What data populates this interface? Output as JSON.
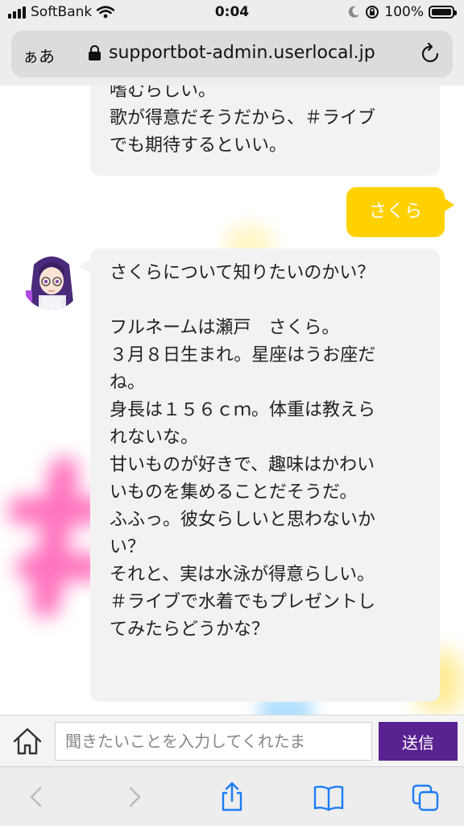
{
  "status_bar": {
    "carrier": "SoftBank",
    "time": "0:04",
    "battery": "100%"
  },
  "browser": {
    "text_size_label": "ぁあ",
    "url": "supportbot-admin.userlocal.jp"
  },
  "messages": {
    "bot_previous": {
      "lines": [
        "嗜むらしい。",
        "歌が得意だそうだから、＃ライブ",
        "でも期待するといい。"
      ]
    },
    "user": {
      "text": "さくら"
    },
    "bot_reply": {
      "lines": [
        "さくらについて知りたいのかい？",
        "",
        "フルネームは瀬戸　さくら。",
        "３月８日生まれ。星座はうお座だ",
        "ね。",
        "身長は１５６ｃｍ。体重は教えら",
        "れないな。",
        "甘いものが好きで、趣味はかわい",
        "いものを集めることだそうだ。",
        "ふふっ。彼女らしいと思わないか",
        "い？",
        "それと、実は水泳が得意らしい。",
        "＃ライブで水着でもプレゼントし",
        "てみたらどうかな？"
      ]
    }
  },
  "input": {
    "placeholder": "聞きたいことを入力してくれたま",
    "send_label": "送信"
  },
  "colors": {
    "user_bubble": "#ffd100",
    "bot_bubble": "#f2f2f2",
    "send_button": "#5a2190",
    "safari_blue": "#1a7cf5"
  }
}
